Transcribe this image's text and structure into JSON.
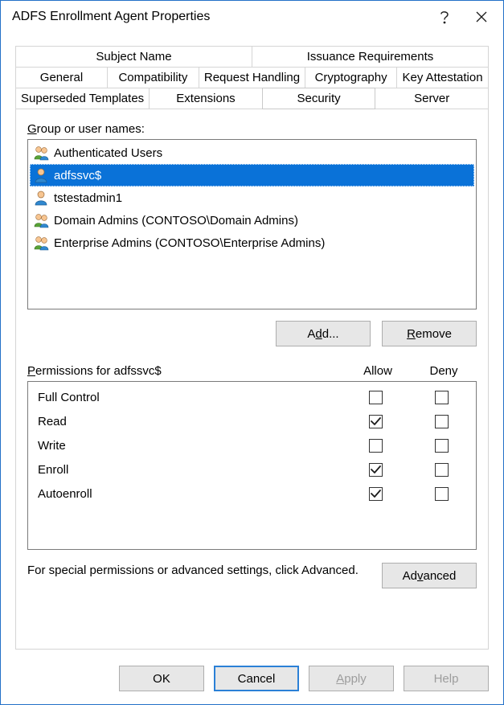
{
  "window": {
    "title": "ADFS Enrollment Agent Properties"
  },
  "tabs_row1": [
    {
      "label": "Subject Name"
    },
    {
      "label": "Issuance Requirements"
    }
  ],
  "tabs_row2": [
    {
      "label": "General"
    },
    {
      "label": "Compatibility"
    },
    {
      "label": "Request Handling"
    },
    {
      "label": "Cryptography"
    },
    {
      "label": "Key Attestation"
    }
  ],
  "tabs_row3": [
    {
      "label": "Superseded Templates"
    },
    {
      "label": "Extensions"
    },
    {
      "label": "Security",
      "active": true
    },
    {
      "label": "Server"
    }
  ],
  "labels": {
    "group_or_user_prefix": "G",
    "group_or_user_rest": "roup or user names:",
    "add_button_prefix": "A",
    "add_button_und": "d",
    "add_button_suffix": "d...",
    "remove_button_und": "R",
    "remove_button_suffix": "emove",
    "permissions_und": "P",
    "permissions_rest": "ermissions for adfssvc$",
    "col_allow": "Allow",
    "col_deny": "Deny",
    "advanced_text": "For special permissions or advanced settings, click Advanced.",
    "advanced_pre": "Ad",
    "advanced_und": "v",
    "advanced_suf": "anced",
    "apply_und": "A",
    "apply_suf": "pply",
    "help": "Help",
    "ok": "OK",
    "cancel": "Cancel"
  },
  "users": [
    {
      "name": "Authenticated Users",
      "icon": "group",
      "selected": false
    },
    {
      "name": "adfssvc$",
      "icon": "user",
      "selected": true
    },
    {
      "name": "tstestadmin1",
      "icon": "user",
      "selected": false
    },
    {
      "name": "Domain Admins (CONTOSO\\Domain Admins)",
      "icon": "group",
      "selected": false
    },
    {
      "name": "Enterprise Admins (CONTOSO\\Enterprise Admins)",
      "icon": "group",
      "selected": false
    }
  ],
  "permissions": [
    {
      "name": "Full Control",
      "allow": false,
      "deny": false
    },
    {
      "name": "Read",
      "allow": true,
      "deny": false
    },
    {
      "name": "Write",
      "allow": false,
      "deny": false
    },
    {
      "name": "Enroll",
      "allow": true,
      "deny": false
    },
    {
      "name": "Autoenroll",
      "allow": true,
      "deny": false
    }
  ]
}
